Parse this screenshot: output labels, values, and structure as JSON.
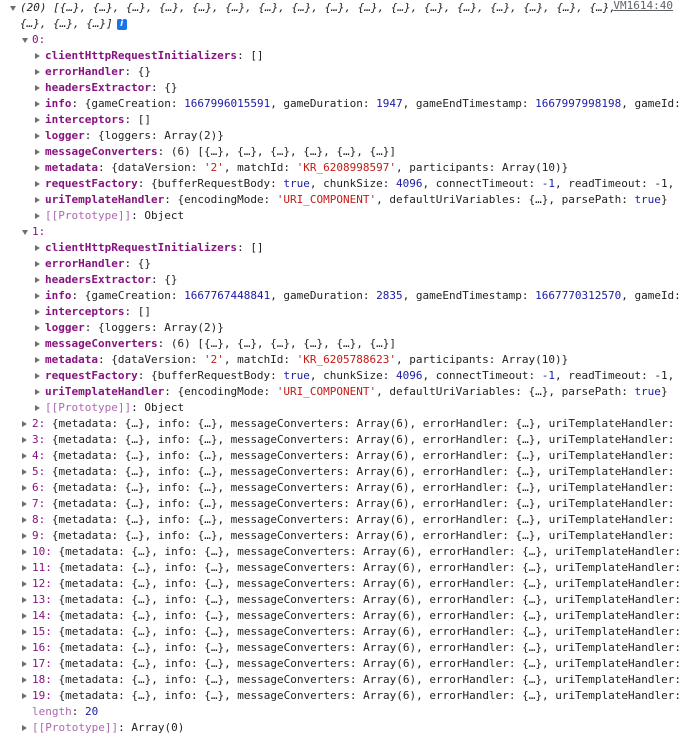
{
  "source_link": "VM1614:40",
  "root": {
    "summary_line1": "(20) [{…}, {…}, {…}, {…}, {…}, {…}, {…}, {…}, {…}, {…}, {…}, {…}, {…}, {…}, {…}, {…}, {…},",
    "summary_line2": "{…}, {…}, {…}]",
    "info_badge": "i",
    "length_label": "length",
    "length_value": "20",
    "prototype_label": "[[Prototype]]",
    "prototype_value": "Array(0)"
  },
  "expanded": [
    {
      "index": "0",
      "props": {
        "clientHttpRequestInitializers": "[]",
        "errorHandler": "{}",
        "headersExtractor": "{}",
        "info_a": "{gameCreation: ",
        "info_creation": "1667996015591",
        "info_b": ", gameDuration: ",
        "info_duration": "1947",
        "info_c": ", gameEndTimestamp: ",
        "info_end": "1667997998198",
        "info_d": ", gameId:",
        "interceptors": "[]",
        "logger": "{loggers: Array(2)}",
        "messageConverters": "(6) [{…}, {…}, {…}, {…}, {…}, {…}]",
        "meta_a": "{dataVersion: ",
        "meta_version": "'2'",
        "meta_b": ", matchId: ",
        "meta_match": "'KR_6208998597'",
        "meta_c": ", participants: Array(10)}",
        "rf_a": "{bufferRequestBody: ",
        "rf_buffer": "true",
        "rf_b": ", chunkSize: ",
        "rf_chunk": "4096",
        "rf_c": ", connectTimeout: ",
        "rf_connect": "-1",
        "rf_d": ", readTimeout: -1,",
        "uth_a": "{encodingMode: ",
        "uth_mode": "'URI_COMPONENT'",
        "uth_b": ", defaultUriVariables: {…}, parsePath: ",
        "uth_parse": "true",
        "uth_c": "}",
        "prototype": "Object"
      }
    },
    {
      "index": "1",
      "props": {
        "clientHttpRequestInitializers": "[]",
        "errorHandler": "{}",
        "headersExtractor": "{}",
        "info_a": "{gameCreation: ",
        "info_creation": "1667767448841",
        "info_b": ", gameDuration: ",
        "info_duration": "2835",
        "info_c": ", gameEndTimestamp: ",
        "info_end": "1667770312570",
        "info_d": ", gameId:",
        "interceptors": "[]",
        "logger": "{loggers: Array(2)}",
        "messageConverters": "(6) [{…}, {…}, {…}, {…}, {…}, {…}]",
        "meta_a": "{dataVersion: ",
        "meta_version": "'2'",
        "meta_b": ", matchId: ",
        "meta_match": "'KR_6205788623'",
        "meta_c": ", participants: Array(10)}",
        "rf_a": "{bufferRequestBody: ",
        "rf_buffer": "true",
        "rf_b": ", chunkSize: ",
        "rf_chunk": "4096",
        "rf_c": ", connectTimeout: ",
        "rf_connect": "-1",
        "rf_d": ", readTimeout: -1,",
        "uth_a": "{encodingMode: ",
        "uth_mode": "'URI_COMPONENT'",
        "uth_b": ", defaultUriVariables: {…}, parsePath: ",
        "uth_parse": "true",
        "uth_c": "}",
        "prototype": "Object"
      }
    }
  ],
  "prop_keys": {
    "clientHttpRequestInitializers": "clientHttpRequestInitializers",
    "errorHandler": "errorHandler",
    "headersExtractor": "headersExtractor",
    "info": "info",
    "interceptors": "interceptors",
    "logger": "logger",
    "messageConverters": "messageConverters",
    "metadata": "metadata",
    "requestFactory": "requestFactory",
    "uriTemplateHandler": "uriTemplateHandler",
    "prototype": "[[Prototype]]"
  },
  "collapsed_preview": "{metadata: {…}, info: {…}, messageConverters: Array(6), errorHandler: {…}, uriTemplateHandler:",
  "collapsed_rows": [
    "2",
    "3",
    "4",
    "5",
    "6",
    "7",
    "8",
    "9",
    "10",
    "11",
    "12",
    "13",
    "14",
    "15",
    "16",
    "17",
    "18",
    "19"
  ],
  "colors": {
    "key": "#881280",
    "number": "#1a1aa6",
    "string": "#c41a16",
    "badge": "#1a73e8"
  }
}
